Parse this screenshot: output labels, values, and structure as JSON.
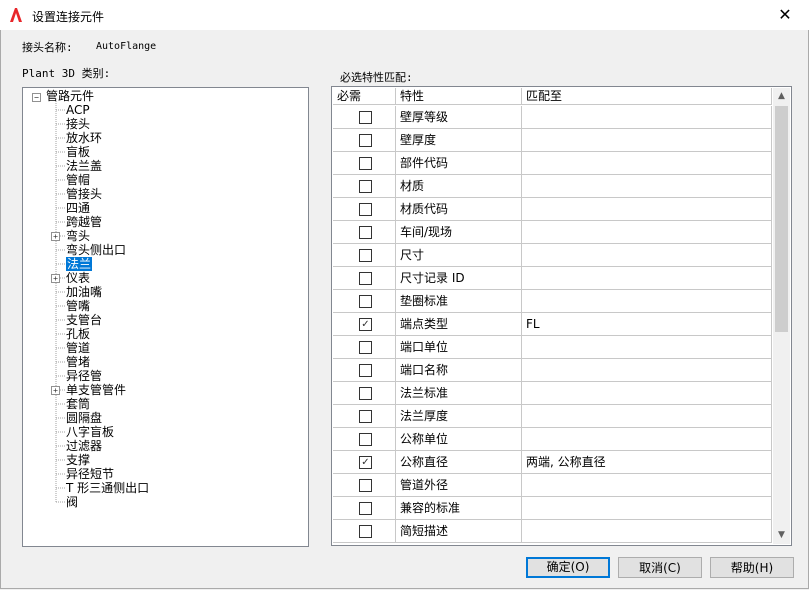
{
  "window": {
    "title": "设置连接元件",
    "close_glyph": "✕",
    "app_icon": "autocad-a-icon"
  },
  "connector": {
    "label": "接头名称:",
    "value": "AutoFlange"
  },
  "category": {
    "label": "Plant 3D 类别:",
    "root": "管路元件",
    "items": [
      {
        "label": "ACP"
      },
      {
        "label": "接头"
      },
      {
        "label": "放水环"
      },
      {
        "label": "盲板"
      },
      {
        "label": "法兰盖"
      },
      {
        "label": "管帽"
      },
      {
        "label": "管接头"
      },
      {
        "label": "四通"
      },
      {
        "label": "跨越管"
      },
      {
        "label": "弯头",
        "expandable": true
      },
      {
        "label": "弯头侧出口"
      },
      {
        "label": "法兰",
        "selected": true
      },
      {
        "label": "仪表",
        "expandable": true
      },
      {
        "label": "加油嘴"
      },
      {
        "label": "管嘴"
      },
      {
        "label": "支管台"
      },
      {
        "label": "孔板"
      },
      {
        "label": "管道"
      },
      {
        "label": "管堵"
      },
      {
        "label": "异径管"
      },
      {
        "label": "单支管管件",
        "expandable": true
      },
      {
        "label": "套筒"
      },
      {
        "label": "圆隔盘"
      },
      {
        "label": "八字盲板"
      },
      {
        "label": "过滤器"
      },
      {
        "label": "支撑"
      },
      {
        "label": "异径短节"
      },
      {
        "label": "T 形三通侧出口"
      },
      {
        "label": "阀"
      }
    ]
  },
  "match": {
    "label": "必选特性匹配:",
    "headers": [
      "必需",
      "特性",
      "匹配至"
    ],
    "rows": [
      {
        "checked": false,
        "property": "壁厚等级",
        "match": ""
      },
      {
        "checked": false,
        "property": "壁厚度",
        "match": ""
      },
      {
        "checked": false,
        "property": "部件代码",
        "match": ""
      },
      {
        "checked": false,
        "property": "材质",
        "match": ""
      },
      {
        "checked": false,
        "property": "材质代码",
        "match": ""
      },
      {
        "checked": false,
        "property": "车间/现场",
        "match": ""
      },
      {
        "checked": false,
        "property": "尺寸",
        "match": ""
      },
      {
        "checked": false,
        "property": "尺寸记录 ID",
        "match": ""
      },
      {
        "checked": false,
        "property": "垫圈标准",
        "match": ""
      },
      {
        "checked": true,
        "property": "端点类型",
        "match": "FL"
      },
      {
        "checked": false,
        "property": "端口单位",
        "match": ""
      },
      {
        "checked": false,
        "property": "端口名称",
        "match": ""
      },
      {
        "checked": false,
        "property": "法兰标准",
        "match": ""
      },
      {
        "checked": false,
        "property": "法兰厚度",
        "match": ""
      },
      {
        "checked": false,
        "property": "公称单位",
        "match": ""
      },
      {
        "checked": true,
        "property": "公称直径",
        "match": "两端, 公称直径"
      },
      {
        "checked": false,
        "property": "管道外径",
        "match": ""
      },
      {
        "checked": false,
        "property": "兼容的标准",
        "match": ""
      },
      {
        "checked": false,
        "property": "简短描述",
        "match": ""
      }
    ]
  },
  "buttons": {
    "ok": "确定(O)",
    "cancel": "取消(C)",
    "help": "帮助(H)"
  }
}
